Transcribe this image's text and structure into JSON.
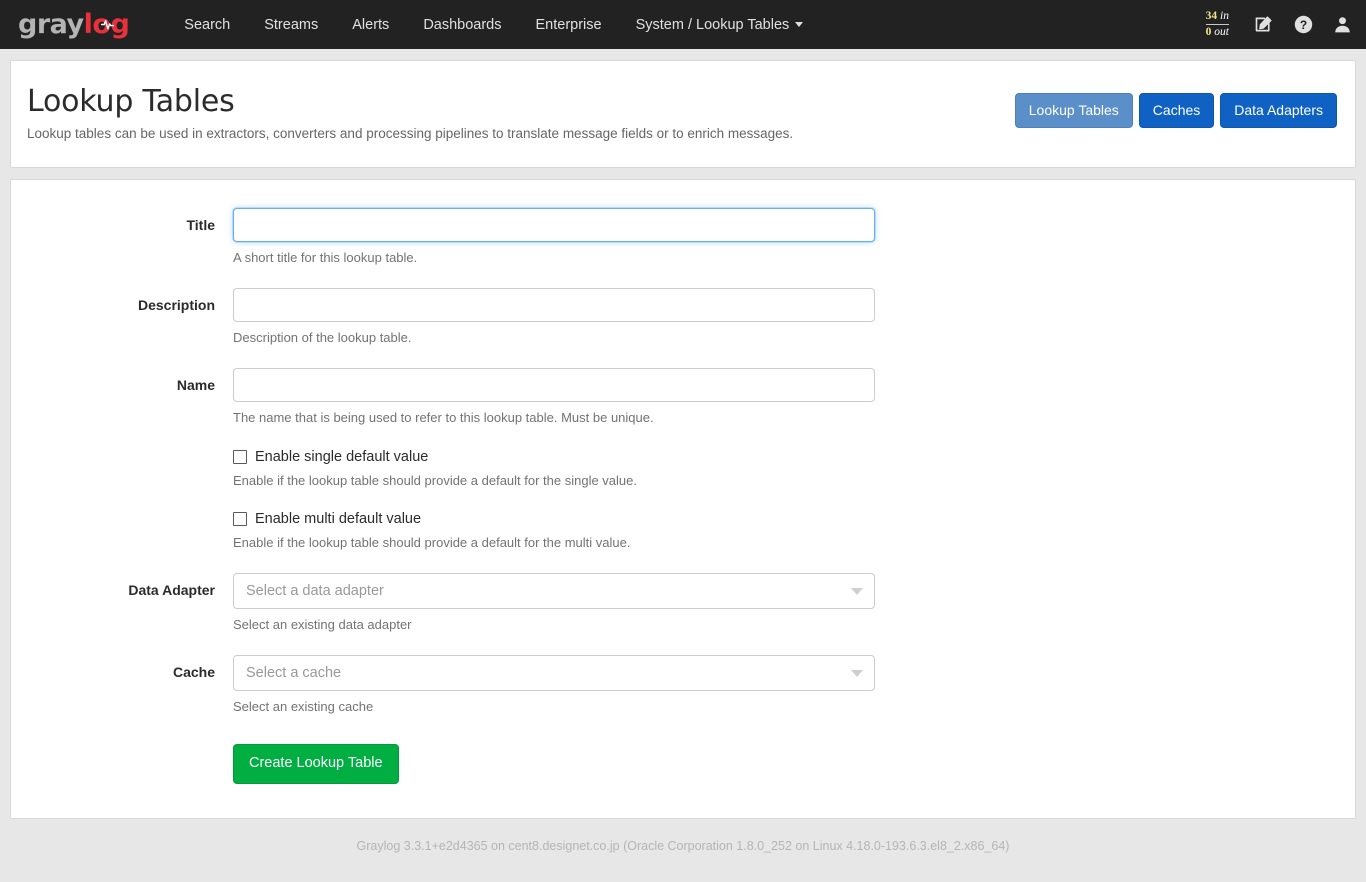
{
  "navbar": {
    "brand": {
      "part1": "gray",
      "part2": "log",
      "icon": "pulse-icon"
    },
    "links": [
      {
        "label": "Search",
        "name": "nav-link-search"
      },
      {
        "label": "Streams",
        "name": "nav-link-streams"
      },
      {
        "label": "Alerts",
        "name": "nav-link-alerts"
      },
      {
        "label": "Dashboards",
        "name": "nav-link-dashboards"
      },
      {
        "label": "Enterprise",
        "name": "nav-link-enterprise"
      },
      {
        "label": "System / Lookup Tables",
        "name": "nav-link-system",
        "has_caret": true
      }
    ],
    "throughput": {
      "in_value": "34",
      "in_label": "in",
      "out_value": "0",
      "out_label": "out"
    },
    "icons": [
      {
        "name": "edit-pencil-icon"
      },
      {
        "name": "help-question-icon"
      },
      {
        "name": "user-account-icon"
      }
    ]
  },
  "header": {
    "title": "Lookup Tables",
    "description": "Lookup tables can be used in extractors, converters and processing pipelines to translate message fields or to enrich messages.",
    "actions": [
      {
        "label": "Lookup Tables",
        "name": "lookup-tables-button",
        "active": true
      },
      {
        "label": "Caches",
        "name": "caches-button",
        "active": false
      },
      {
        "label": "Data Adapters",
        "name": "data-adapters-button",
        "active": false
      }
    ]
  },
  "form": {
    "title": {
      "label": "Title",
      "value": "",
      "placeholder": "",
      "help": "A short title for this lookup table.",
      "focused": true
    },
    "description": {
      "label": "Description",
      "value": "",
      "placeholder": "",
      "help": "Description of the lookup table.",
      "focused": false
    },
    "name": {
      "label": "Name",
      "value": "",
      "placeholder": "",
      "help": "The name that is being used to refer to this lookup table. Must be unique.",
      "focused": false
    },
    "single_default": {
      "label": "Enable single default value",
      "help": "Enable if the lookup table should provide a default for the single value.",
      "checked": false
    },
    "multi_default": {
      "label": "Enable multi default value",
      "help": "Enable if the lookup table should provide a default for the multi value.",
      "checked": false
    },
    "data_adapter": {
      "label": "Data Adapter",
      "placeholder": "Select a data adapter",
      "selected": "",
      "help": "Select an existing data adapter"
    },
    "cache": {
      "label": "Cache",
      "placeholder": "Select a cache",
      "selected": "",
      "help": "Select an existing cache"
    },
    "submit": {
      "label": "Create Lookup Table"
    }
  },
  "footer": {
    "text": "Graylog 3.3.1+e2d4365 on cent8.designet.co.jp (Oracle Corporation 1.8.0_252 on Linux 4.18.0-193.6.3.el8_2.x86_64)"
  },
  "colors": {
    "navbar_bg": "#222222",
    "brand_gray": "#b4b4b4",
    "brand_red": "#e8313b",
    "page_bg": "#e7e7e7",
    "primary_blue": "#0f62c4",
    "active_blue": "#5b8fc9",
    "success_green": "#00ae42",
    "focus_blue": "#66afe9",
    "throughput_number": "#f0e68c"
  }
}
